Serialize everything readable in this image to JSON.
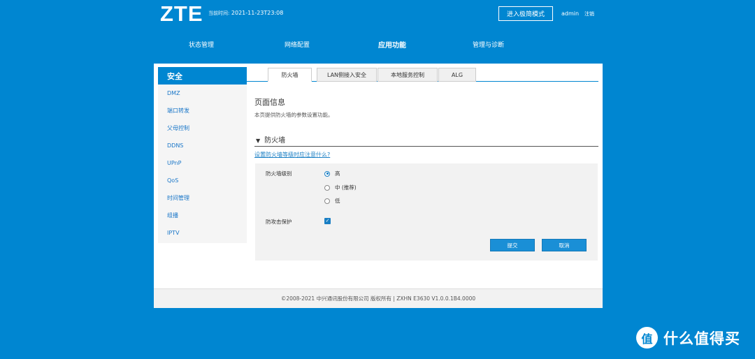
{
  "header": {
    "logo": "ZTE",
    "time_label": "当前时间:",
    "time_value": "2021-11-23T23:08",
    "advanced_button": "进入极简模式",
    "user": "admin",
    "logout": "注销"
  },
  "nav": {
    "items": [
      {
        "label": "状态管理",
        "active": false
      },
      {
        "label": "网络配置",
        "active": false
      },
      {
        "label": "应用功能",
        "active": true
      },
      {
        "label": "管理与诊断",
        "active": false
      }
    ]
  },
  "sidebar": {
    "title": "安全",
    "items": [
      {
        "label": "DMZ"
      },
      {
        "label": "端口转发"
      },
      {
        "label": "父母控制"
      },
      {
        "label": "DDNS"
      },
      {
        "label": "UPnP"
      },
      {
        "label": "QoS"
      },
      {
        "label": "时间管理"
      },
      {
        "label": "组播"
      },
      {
        "label": "IPTV"
      }
    ]
  },
  "tabs": [
    {
      "label": "防火墙",
      "active": true
    },
    {
      "label": "LAN侧接入安全",
      "active": false
    },
    {
      "label": "本地服务控制",
      "active": false
    },
    {
      "label": "ALG",
      "active": false
    }
  ],
  "content": {
    "page_title": "页面信息",
    "page_desc": "本页提供防火墙的参数设置功能。",
    "section_title": "防火墙",
    "help_link": "设置防火墙等级时应注意什么?",
    "firewall_level_label": "防火墙级别",
    "levels": [
      {
        "label": "高",
        "selected": true
      },
      {
        "label": "中 (推荐)",
        "selected": false
      },
      {
        "label": "低",
        "selected": false
      }
    ],
    "attack_protection_label": "防攻击保护",
    "attack_protection_checked": true,
    "submit_label": "提交",
    "cancel_label": "取消"
  },
  "footer": {
    "copyright": "©2008-2021 中兴通讯股份有限公司 版权所有 | ZXHN E3630 V1.0.0.1B4.0000"
  },
  "watermark": {
    "icon_text": "值",
    "text": "什么值得买"
  },
  "colors": {
    "brand_blue": "#0086d1",
    "button_blue": "#1a8fd6",
    "link_blue": "#1a7fc4"
  }
}
